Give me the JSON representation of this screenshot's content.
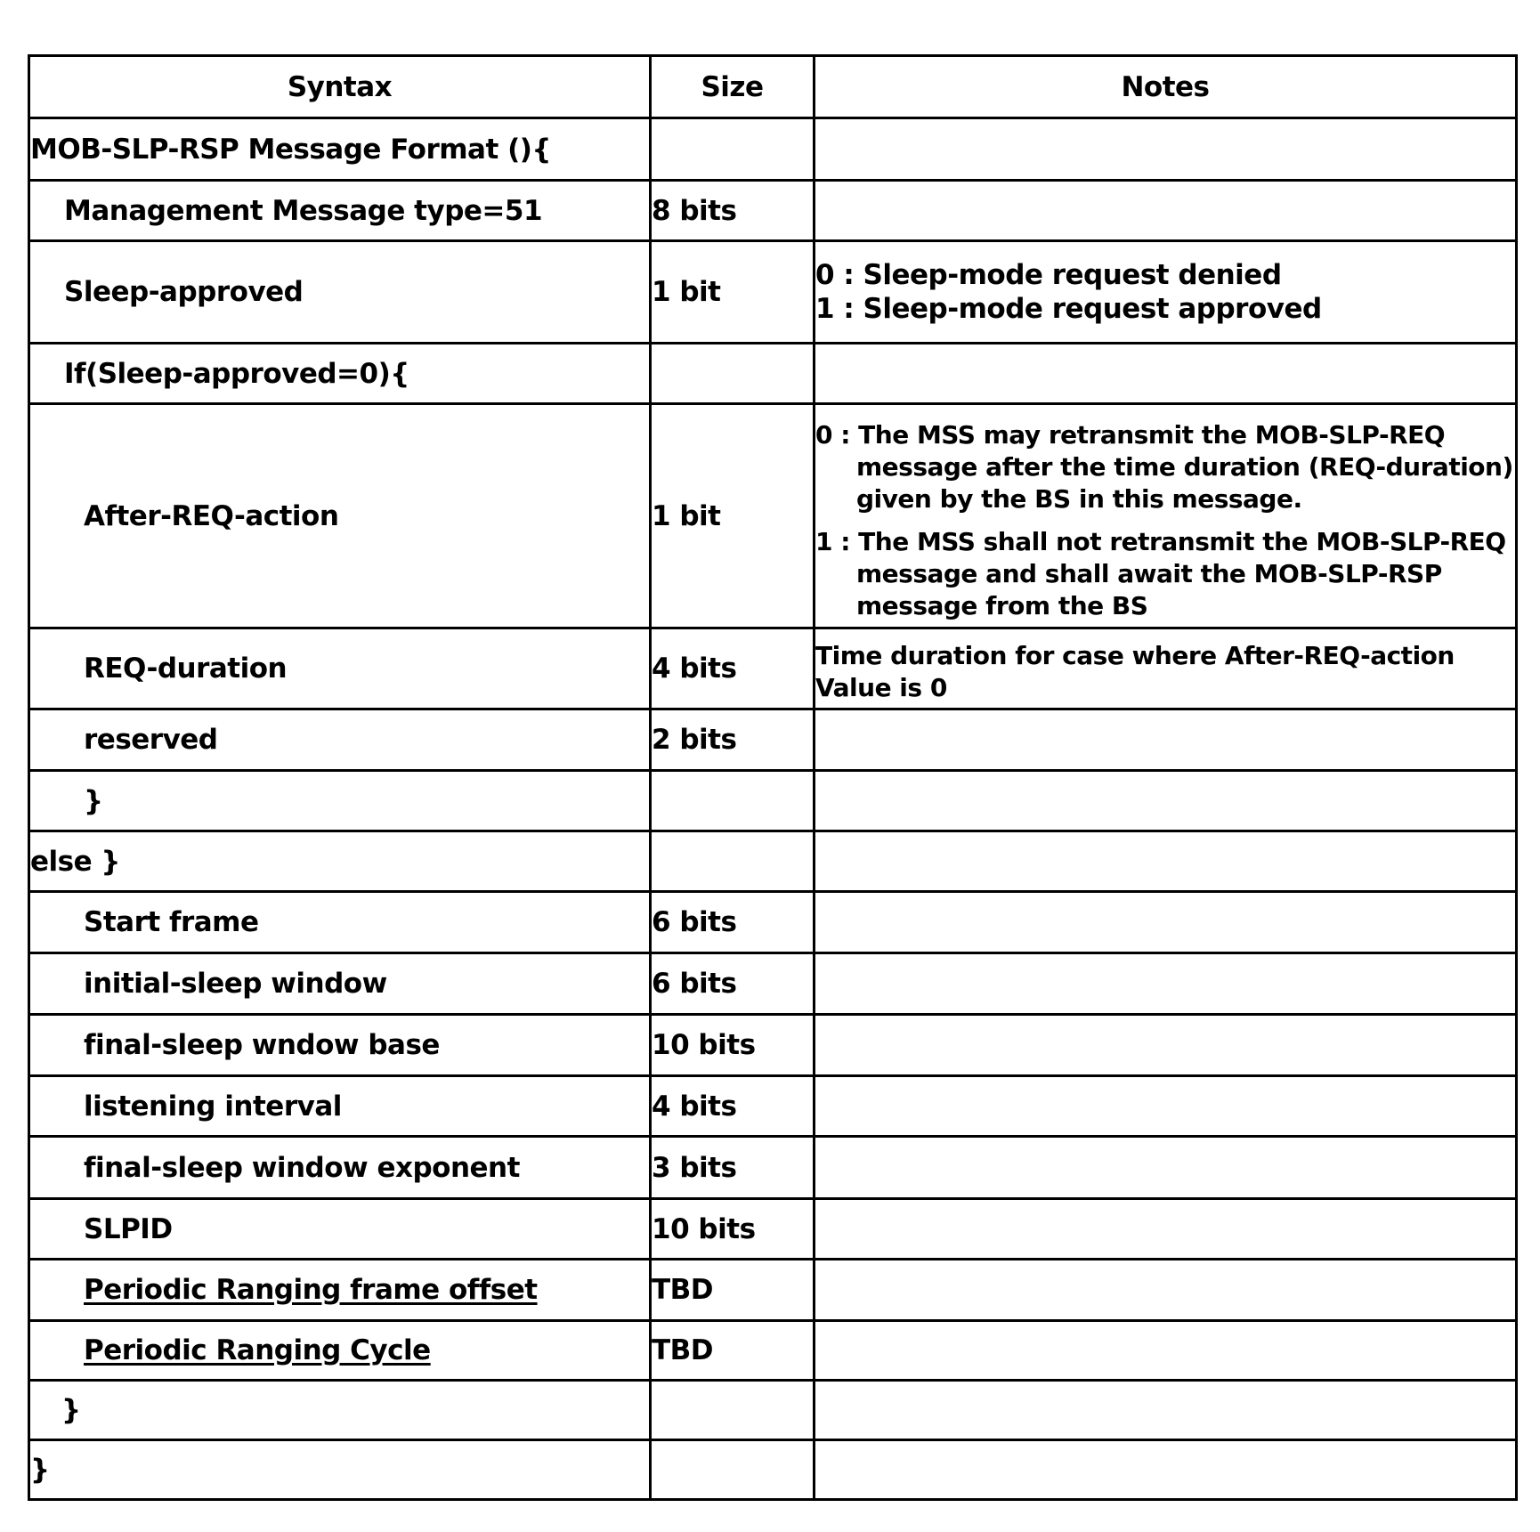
{
  "table": {
    "headers": {
      "syntax": "Syntax",
      "size": "Size",
      "notes": "Notes"
    },
    "rows": [
      {
        "syntax": "MOB-SLP-RSP Message Format (){",
        "size": "",
        "notes": ""
      },
      {
        "syntax": "Management Message type=51",
        "size": "8 bits",
        "notes": ""
      },
      {
        "syntax": "Sleep-approved",
        "size": "1 bit",
        "notes_lines": [
          "0 : Sleep-mode request denied",
          "1 : Sleep-mode request approved"
        ]
      },
      {
        "syntax": "If(Sleep-approved=0){",
        "size": "",
        "notes": ""
      },
      {
        "syntax": "After-REQ-action",
        "size": "1 bit",
        "notes_lines": [
          "0 : The MSS may retransmit the MOB-SLP-REQ message after the time duration (REQ-duration) given by the BS in this message.",
          "1 : The MSS shall not retransmit the MOB-SLP-REQ message and shall await the MOB-SLP-RSP message from the BS"
        ]
      },
      {
        "syntax": "REQ-duration",
        "size": "4 bits",
        "notes": "Time duration for case where After-REQ-action Value is 0"
      },
      {
        "syntax": "reserved",
        "size": "2 bits",
        "notes": ""
      },
      {
        "syntax": "}",
        "size": "",
        "notes": ""
      },
      {
        "syntax": "else }",
        "size": "",
        "notes": ""
      },
      {
        "syntax": "Start frame",
        "size": "6 bits",
        "notes": ""
      },
      {
        "syntax": "initial-sleep window",
        "size": "6 bits",
        "notes": ""
      },
      {
        "syntax": "final-sleep wndow base",
        "size": "10 bits",
        "notes": ""
      },
      {
        "syntax": "listening interval",
        "size": "4 bits",
        "notes": ""
      },
      {
        "syntax": "final-sleep window exponent",
        "size": "3 bits",
        "notes": ""
      },
      {
        "syntax": "SLPID",
        "size": "10 bits",
        "notes": ""
      },
      {
        "syntax": "Periodic Ranging frame offset",
        "size": "TBD",
        "notes": ""
      },
      {
        "syntax": "Periodic Ranging Cycle",
        "size": "TBD",
        "notes": ""
      },
      {
        "syntax": "}",
        "size": "",
        "notes": ""
      },
      {
        "syntax": "}",
        "size": "",
        "notes": ""
      }
    ]
  }
}
